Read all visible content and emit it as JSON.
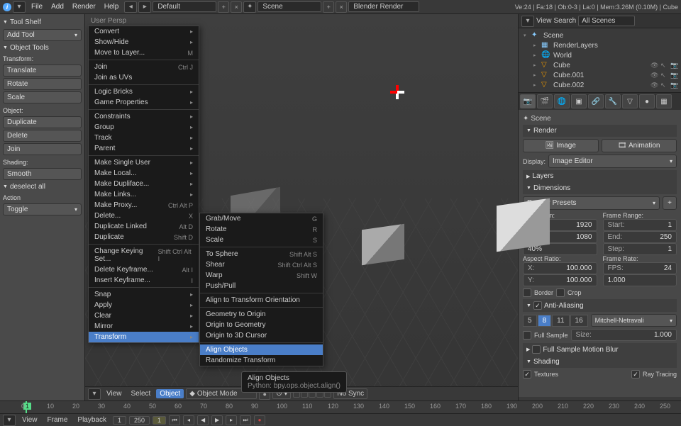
{
  "topbar": {
    "menus": [
      "File",
      "Add",
      "Render",
      "Help"
    ],
    "layout_field": "Default",
    "scene_field": "Scene",
    "engine": "Blender Render",
    "stats": "Ve:24 | Fa:18 | Ob:0-3 | La:0 | Mem:3.26M (0.10M) | Cube"
  },
  "tool_shelf": {
    "header": "Tool Shelf",
    "add_tool": "Add Tool",
    "object_tools": "Object Tools",
    "transform_label": "Transform:",
    "translate": "Translate",
    "rotate": "Rotate",
    "scale": "Scale",
    "object_label": "Object:",
    "duplicate": "Duplicate",
    "delete": "Delete",
    "join": "Join",
    "shading_label": "Shading:",
    "smooth": "Smooth",
    "deselect": "deselect all",
    "action_label": "Action",
    "toggle": "Toggle"
  },
  "viewport": {
    "perspective": "User Persp"
  },
  "object_menu": {
    "items": [
      {
        "label": "Convert",
        "sub": true
      },
      {
        "label": "Show/Hide",
        "sub": true
      },
      {
        "label": "Move to Layer...",
        "shortcut": "M"
      },
      {
        "sep": true
      },
      {
        "label": "Join",
        "shortcut": "Ctrl J"
      },
      {
        "label": "Join as UVs"
      },
      {
        "sep": true
      },
      {
        "label": "Logic Bricks",
        "sub": true
      },
      {
        "label": "Game Properties",
        "sub": true
      },
      {
        "sep": true
      },
      {
        "label": "Constraints",
        "sub": true
      },
      {
        "label": "Group",
        "sub": true
      },
      {
        "label": "Track",
        "sub": true
      },
      {
        "label": "Parent",
        "sub": true
      },
      {
        "sep": true
      },
      {
        "label": "Make Single User",
        "sub": true
      },
      {
        "label": "Make Local...",
        "sub": true
      },
      {
        "label": "Make Dupliface...",
        "sub": true
      },
      {
        "label": "Make Links...",
        "sub": true
      },
      {
        "label": "Make Proxy...",
        "shortcut": "Ctrl Alt P"
      },
      {
        "label": "Delete...",
        "shortcut": "X"
      },
      {
        "label": "Duplicate Linked",
        "shortcut": "Alt D"
      },
      {
        "label": "Duplicate",
        "shortcut": "Shift D"
      },
      {
        "sep": true
      },
      {
        "label": "Change Keying Set...",
        "shortcut": "Shift Ctrl Alt I"
      },
      {
        "label": "Delete Keyframe...",
        "shortcut": "Alt I"
      },
      {
        "label": "Insert Keyframe...",
        "shortcut": "I"
      },
      {
        "sep": true
      },
      {
        "label": "Snap",
        "sub": true
      },
      {
        "label": "Apply",
        "sub": true
      },
      {
        "label": "Clear",
        "sub": true
      },
      {
        "label": "Mirror",
        "sub": true
      },
      {
        "label": "Transform",
        "sub": true,
        "highlighted": true
      }
    ]
  },
  "transform_submenu": {
    "items": [
      {
        "label": "Grab/Move",
        "shortcut": "G"
      },
      {
        "label": "Rotate",
        "shortcut": "R"
      },
      {
        "label": "Scale",
        "shortcut": "S"
      },
      {
        "sep": true
      },
      {
        "label": "To Sphere",
        "shortcut": "Shift Alt S"
      },
      {
        "label": "Shear",
        "shortcut": "Shift Ctrl Alt S"
      },
      {
        "label": "Warp",
        "shortcut": "Shift W"
      },
      {
        "label": "Push/Pull"
      },
      {
        "sep": true
      },
      {
        "label": "Align to Transform Orientation"
      },
      {
        "sep": true
      },
      {
        "label": "Geometry to Origin"
      },
      {
        "label": "Origin to Geometry"
      },
      {
        "label": "Origin to 3D Cursor"
      },
      {
        "sep": true
      },
      {
        "label": "Align Objects",
        "highlighted": true
      },
      {
        "label": "Randomize Transform"
      }
    ]
  },
  "tooltip": {
    "title": "Align Objects",
    "python": "Python: bpy.ops.object.align()"
  },
  "viewport_footer": {
    "view": "View",
    "select": "Select",
    "object": "Object",
    "mode": "Object Mode",
    "nosync": "No Sync"
  },
  "outliner": {
    "view": "View",
    "search": "Search",
    "filter": "All Scenes",
    "items": [
      {
        "label": "Scene",
        "indent": 0,
        "icon": "scene"
      },
      {
        "label": "RenderLayers",
        "indent": 1,
        "icon": "layers"
      },
      {
        "label": "World",
        "indent": 1,
        "icon": "world"
      },
      {
        "label": "Cube",
        "indent": 1,
        "icon": "mesh",
        "restrictors": true
      },
      {
        "label": "Cube.001",
        "indent": 1,
        "icon": "mesh",
        "restrictors": true
      },
      {
        "label": "Cube.002",
        "indent": 1,
        "icon": "mesh",
        "restrictors": true
      }
    ]
  },
  "properties": {
    "breadcrumb": "Scene",
    "render_header": "Render",
    "image_btn": "Image",
    "animation_btn": "Animation",
    "display_label": "Display:",
    "display_value": "Image Editor",
    "layers_header": "Layers",
    "dimensions_header": "Dimensions",
    "render_presets": "Render Presets",
    "resolution_label": "Resolution:",
    "res_x": {
      "label": "X:",
      "value": "1920"
    },
    "res_y": {
      "label": "Y:",
      "value": "1080"
    },
    "res_pct": "40%",
    "frame_range_label": "Frame Range:",
    "start": {
      "label": "Start:",
      "value": "1"
    },
    "end": {
      "label": "End:",
      "value": "250"
    },
    "step": {
      "label": "Step:",
      "value": "1"
    },
    "aspect_label": "Aspect Ratio:",
    "asp_x": {
      "label": "X:",
      "value": "100.000"
    },
    "asp_y": {
      "label": "Y:",
      "value": "100.000"
    },
    "framerate_label": "Frame Rate:",
    "fps": {
      "label": "FPS:",
      "value": "24"
    },
    "fps_base": "1.000",
    "border_label": "Border",
    "crop_label": "Crop",
    "aa_header": "Anti-Aliasing",
    "aa_samples": [
      "5",
      "8",
      "11",
      "16"
    ],
    "aa_filter": "Mitchell-Netravali",
    "full_sample": "Full Sample",
    "aa_size": {
      "label": "Size:",
      "value": "1.000"
    },
    "motion_blur_header": "Full Sample Motion Blur",
    "shading_header": "Shading",
    "textures_label": "Textures",
    "raytracing_label": "Ray Tracing"
  },
  "timeline": {
    "view": "View",
    "frame": "Frame",
    "playback": "Playback",
    "ticks": [
      0,
      10,
      20,
      30,
      40,
      50,
      60,
      70,
      80,
      90,
      100,
      110,
      120,
      130,
      140,
      150,
      160,
      170,
      180,
      190,
      200,
      210,
      220,
      230,
      240,
      250
    ],
    "current": "1"
  }
}
